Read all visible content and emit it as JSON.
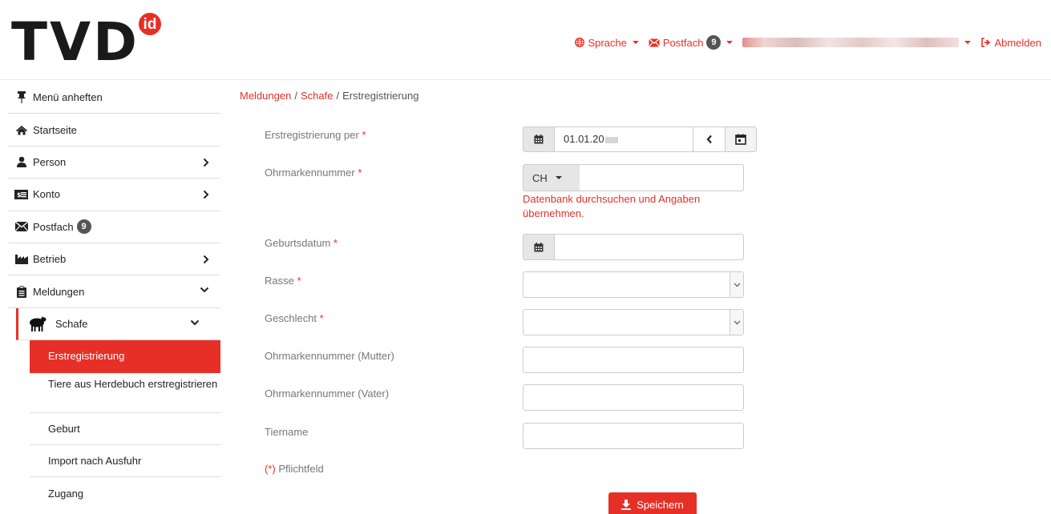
{
  "brand": {
    "logo_text": "TVD",
    "logo_badge": "id",
    "accent": "#e63027"
  },
  "topnav": {
    "language": "Sprache",
    "inbox": "Postfach",
    "inbox_count": "9",
    "logout": "Abmelden"
  },
  "sidebar": {
    "items": [
      {
        "label": "Menü anheften"
      },
      {
        "label": "Startseite"
      },
      {
        "label": "Person"
      },
      {
        "label": "Konto"
      },
      {
        "label": "Postfach",
        "badge": "9"
      },
      {
        "label": "Betrieb"
      },
      {
        "label": "Meldungen"
      },
      {
        "label": "Schafe"
      },
      {
        "label": "Erstregistrierung"
      },
      {
        "label": "Tiere aus Herdebuch erstregistrieren"
      },
      {
        "label": "Geburt"
      },
      {
        "label": "Import nach Ausfuhr"
      },
      {
        "label": "Zugang"
      }
    ]
  },
  "breadcrumb": {
    "level1": "Meldungen",
    "level2": "Schafe",
    "current": "Erstregistrierung",
    "sep": "/"
  },
  "form": {
    "required_marker": "*",
    "registration_date": {
      "label": "Erstregistrierung per",
      "value": "01.01.20"
    },
    "ear_tag": {
      "label": "Ohrmarkennummer",
      "country": "CH",
      "value": "",
      "search_link": "Datenbank durchsuchen und Angaben übernehmen."
    },
    "birth_date": {
      "label": "Geburtsdatum",
      "value": ""
    },
    "breed": {
      "label": "Rasse",
      "value": ""
    },
    "sex": {
      "label": "Geschlecht",
      "value": ""
    },
    "ear_tag_mother": {
      "label": "Ohrmarkennummer (Mutter)",
      "value": ""
    },
    "ear_tag_father": {
      "label": "Ohrmarkennummer (Vater)",
      "value": ""
    },
    "animal_name": {
      "label": "Tiername",
      "value": ""
    },
    "required_note_marker": "(*)",
    "required_note": "Pflichtfeld",
    "save_label": "Speichern"
  },
  "icons": {
    "globe": "globe-icon",
    "envelope": "envelope-icon",
    "logout": "sign-out-icon",
    "pin": "thumbtack-icon",
    "home": "home-icon",
    "user": "user-icon",
    "money": "money-icon",
    "industry": "industry-icon",
    "clipboard": "clipboard-icon",
    "sheep": "sheep-icon",
    "calendar": "calendar-icon",
    "download": "download-icon"
  }
}
